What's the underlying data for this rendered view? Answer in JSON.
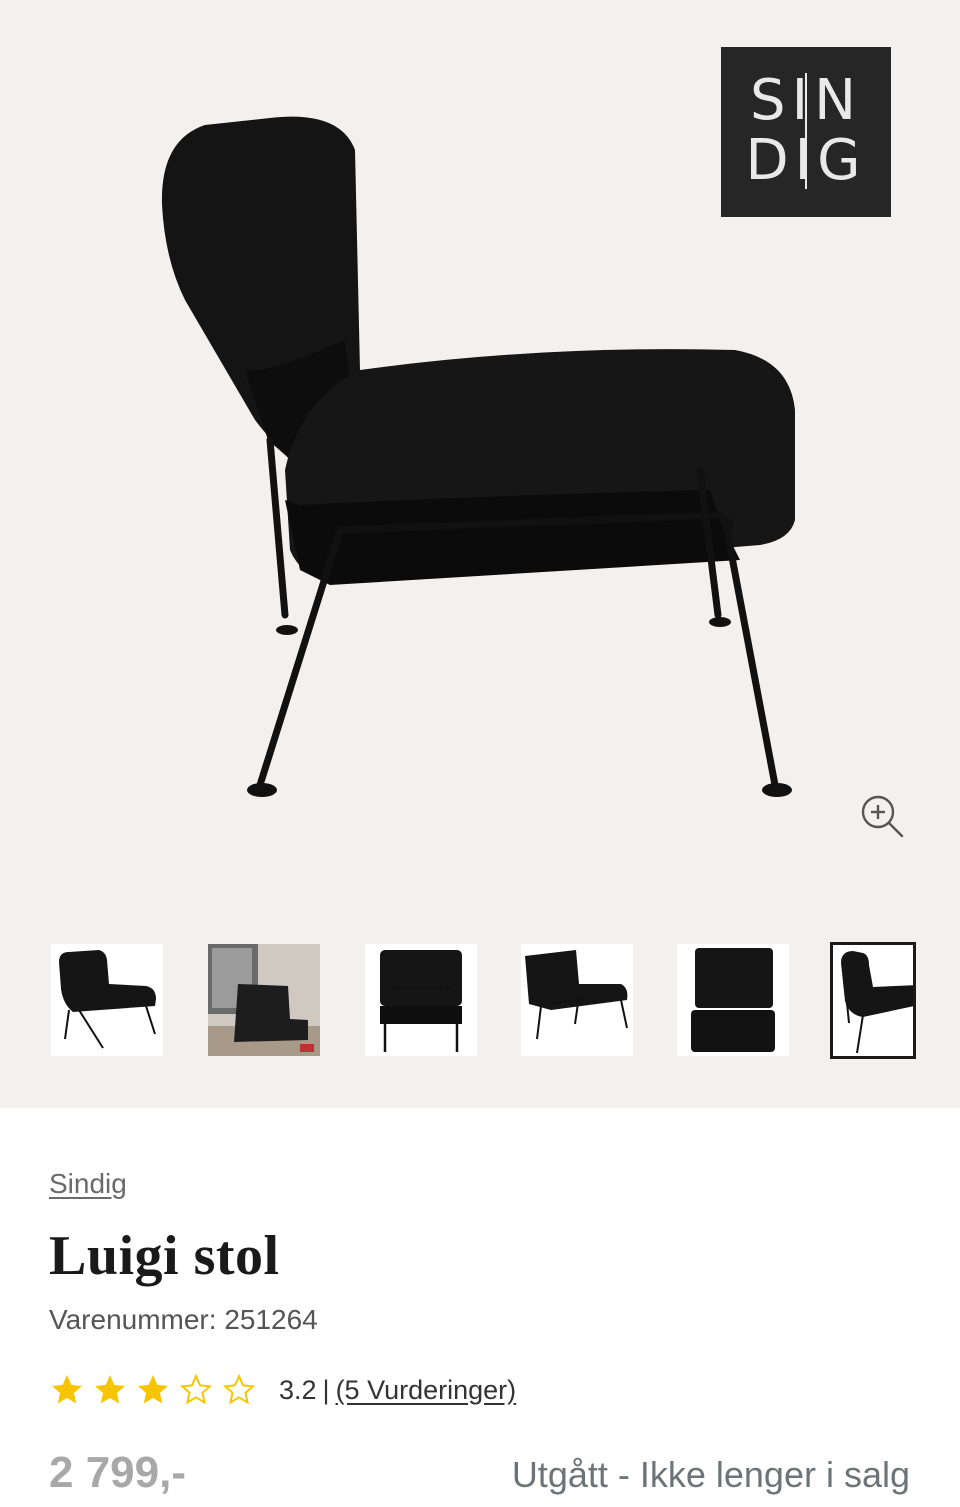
{
  "gallery": {
    "brand_logo": {
      "row1": "SIN",
      "row2": "DIG"
    },
    "zoom_icon": "zoom-in-icon",
    "thumbnails": [
      {
        "label": "side-view"
      },
      {
        "label": "lifestyle"
      },
      {
        "label": "back-view"
      },
      {
        "label": "angle-view"
      },
      {
        "label": "front-view"
      },
      {
        "label": "side-view-selected"
      }
    ]
  },
  "product": {
    "brand": "Sindig",
    "title": "Luigi stol",
    "sku_label": "Varenummer: 251264",
    "rating": {
      "value": "3.2",
      "stars_filled": 3,
      "stars_total": 5,
      "separator": "|",
      "reviews_link": "(5 Vurderinger)"
    },
    "price": "2 799,-",
    "status": "Utgått - Ikke lenger i salg"
  },
  "colors": {
    "star": "#f6c500",
    "price": "#a8a8a8",
    "status": "#6c7478",
    "gallery_bg": "#f3f1ef"
  }
}
